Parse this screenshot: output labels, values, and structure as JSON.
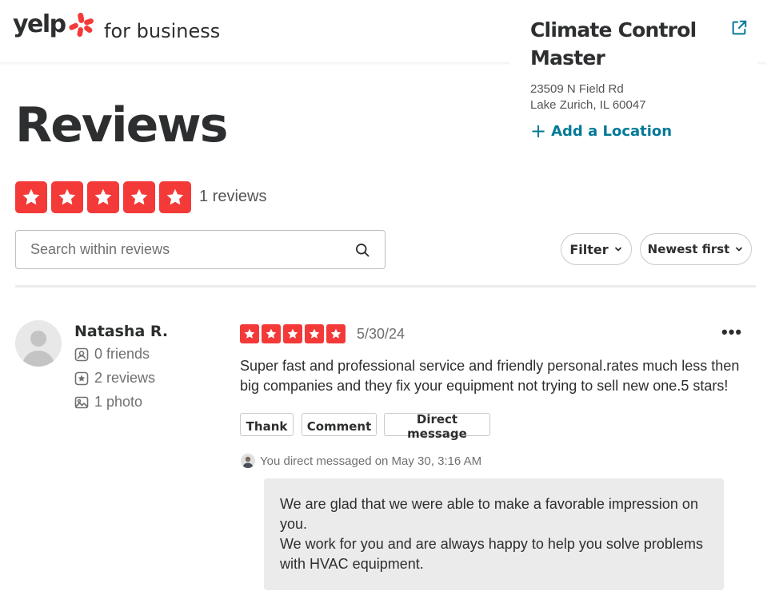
{
  "header": {
    "logo_word": "yelp",
    "logo_sub": "for business"
  },
  "business": {
    "name": "Climate Control Master",
    "address_line1": "23509 N Field Rd",
    "address_line2": "Lake Zurich, IL 60047",
    "add_location_label": "Add a Location"
  },
  "page": {
    "title": "Reviews",
    "rating": 5,
    "review_count": "1 reviews"
  },
  "search": {
    "placeholder": "Search within reviews",
    "value": ""
  },
  "controls": {
    "filter_label": "Filter",
    "sort_label": "Newest first"
  },
  "review": {
    "reviewer_name": "Natasha R.",
    "friends": "0 friends",
    "reviews": "2 reviews",
    "photos": "1 photo",
    "rating": 5,
    "date": "5/30/24",
    "more_label": "•••",
    "text": "Super fast and professional service and friendly personal.rates much less then big companies and they fix your equipment not trying to sell new one.5 stars!",
    "actions": {
      "thank": "Thank",
      "comment": "Comment",
      "direct_message": "Direct message"
    },
    "dm_notice": "You direct messaged on May 30, 3:16 AM",
    "dm_paragraph1": "We are glad that we were able to make a favorable impression on you.",
    "dm_paragraph2": "We work for you and are always happy to help you solve problems with HVAC equipment."
  },
  "colors": {
    "star_red": "#f43939",
    "link_teal": "#027a97",
    "text_dark": "#2d2e2f",
    "text_muted": "#6e7072",
    "bubble_gray": "#ebebeb"
  }
}
